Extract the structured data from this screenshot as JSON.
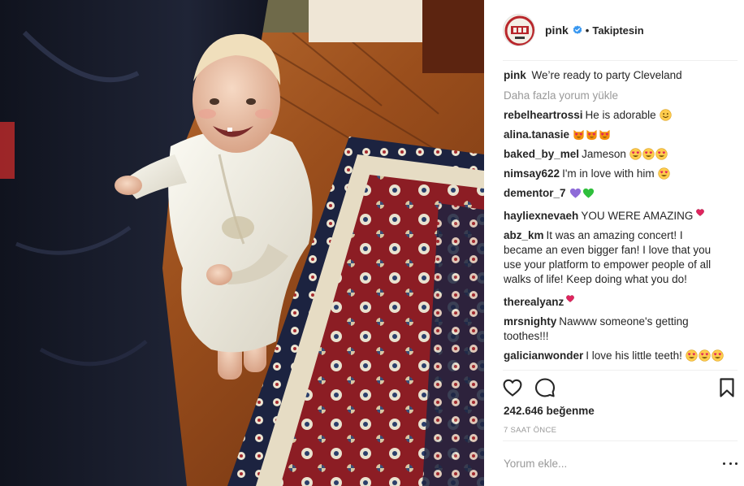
{
  "post": {
    "photo_description": "baby in white robe standing on patterned rug",
    "header": {
      "username": "pink",
      "verified": true,
      "separator": "•",
      "follow_status": "Takiptesin"
    },
    "caption": {
      "user": "pink",
      "text": "We’re ready to party Cleveland"
    },
    "load_more": "Daha fazla yorum yükle",
    "comments": [
      {
        "user": "rebelheartrossi",
        "text": "He is adorable",
        "emojis": [
          "smile"
        ]
      },
      {
        "user": "alina.tanasie",
        "text": "",
        "emojis": [
          "heart-eyes-cat",
          "heart-eyes-cat",
          "heart-eyes-cat"
        ]
      },
      {
        "user": "baked_by_mel",
        "text": "Jameson",
        "emojis": [
          "heart-eyes",
          "heart-eyes",
          "heart-eyes"
        ]
      },
      {
        "user": "nimsay622",
        "text": "I'm in love with him",
        "emojis": [
          "heart-eyes"
        ]
      },
      {
        "user": "dementor_7",
        "text": "",
        "emojis": [
          "purple-heart",
          "green-heart"
        ]
      },
      {
        "user": "hayliexnevaeh",
        "text": "YOU WERE AMAZING",
        "emojis": [
          "small-heart"
        ]
      },
      {
        "user": "abz_km",
        "text": "It was an amazing concert! I became an even bigger fan! I love that you use your platform to empower people of all walks of life! Keep doing what you do!",
        "emojis": []
      },
      {
        "user": "therealyanz",
        "text": "",
        "emojis": [
          "small-heart"
        ]
      },
      {
        "user": "mrsnighty",
        "text": "Nawww someone's getting toothes!!!",
        "emojis": []
      },
      {
        "user": "galicianwonder",
        "text": "I love his little teeth!",
        "emojis": [
          "heart-eyes",
          "heart-eyes",
          "heart-eyes"
        ]
      }
    ],
    "likes": "242.646 beğenme",
    "time": "7 SAAT ÖNCE",
    "comment_placeholder": "Yorum ekle...",
    "icons": {
      "like": "heart-outline-icon",
      "comment": "speech-bubble-icon",
      "save": "bookmark-icon",
      "more": "more-options-icon",
      "verified": "verified-badge-icon"
    },
    "colors": {
      "text": "#262626",
      "secondary_text": "#999999",
      "verified_blue": "#3897f0",
      "divider": "#efefef"
    }
  }
}
